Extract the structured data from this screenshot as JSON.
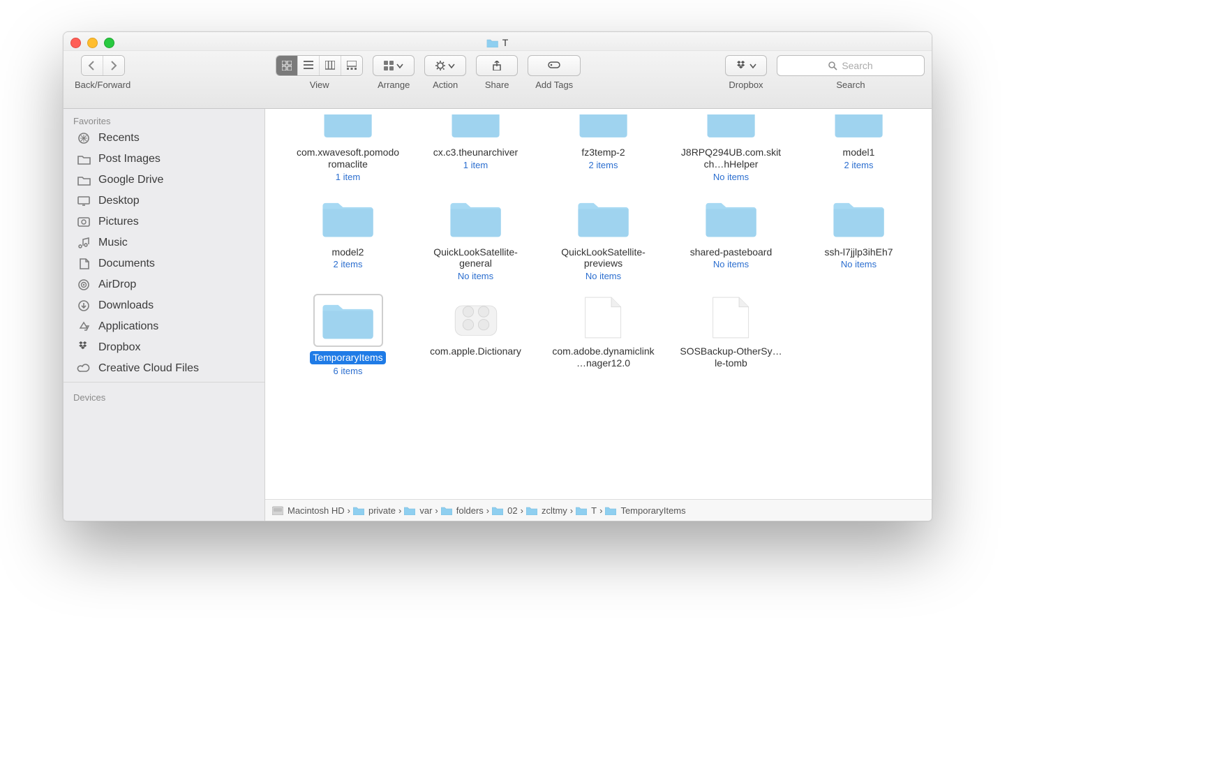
{
  "window": {
    "title": "T"
  },
  "toolbar": {
    "back_forward_label": "Back/Forward",
    "view_label": "View",
    "arrange_label": "Arrange",
    "action_label": "Action",
    "share_label": "Share",
    "add_tags_label": "Add Tags",
    "dropbox_label": "Dropbox",
    "search_label": "Search",
    "search_placeholder": "Search"
  },
  "sidebar": {
    "section_favorites": "Favorites",
    "section_devices": "Devices",
    "items": [
      {
        "icon": "recents",
        "label": "Recents"
      },
      {
        "icon": "folder",
        "label": "Post Images"
      },
      {
        "icon": "folder",
        "label": "Google Drive"
      },
      {
        "icon": "desktop",
        "label": "Desktop"
      },
      {
        "icon": "pictures",
        "label": "Pictures"
      },
      {
        "icon": "music",
        "label": "Music"
      },
      {
        "icon": "documents",
        "label": "Documents"
      },
      {
        "icon": "airdrop",
        "label": "AirDrop"
      },
      {
        "icon": "downloads",
        "label": "Downloads"
      },
      {
        "icon": "applications",
        "label": "Applications"
      },
      {
        "icon": "dropbox",
        "label": "Dropbox"
      },
      {
        "icon": "creative-cloud",
        "label": "Creative Cloud Files"
      }
    ]
  },
  "icons": [
    {
      "type": "folder",
      "name": "com.xwavesoft.pomodoromaclite",
      "meta": "1 item",
      "selected": false,
      "trim": "top"
    },
    {
      "type": "folder",
      "name": "cx.c3.theunarchiver",
      "meta": "1 item",
      "selected": false,
      "trim": "top"
    },
    {
      "type": "folder",
      "name": "fz3temp-2",
      "meta": "2 items",
      "selected": false,
      "trim": "top"
    },
    {
      "type": "folder",
      "name": "J8RPQ294UB.com.skitch…hHelper",
      "meta": "No items",
      "selected": false,
      "trim": "top"
    },
    {
      "type": "folder",
      "name": "model1",
      "meta": "2 items",
      "selected": false,
      "trim": "top"
    },
    {
      "type": "folder",
      "name": "model2",
      "meta": "2 items",
      "selected": false
    },
    {
      "type": "folder",
      "name": "QuickLookSatellite-general",
      "meta": "No items",
      "selected": false
    },
    {
      "type": "folder",
      "name": "QuickLookSatellite-previews",
      "meta": "No items",
      "selected": false
    },
    {
      "type": "folder",
      "name": "shared-pasteboard",
      "meta": "No items",
      "selected": false
    },
    {
      "type": "folder",
      "name": "ssh-l7jjlp3ihEh7",
      "meta": "No items",
      "selected": false
    },
    {
      "type": "folder",
      "name": "TemporaryItems",
      "meta": "6 items",
      "selected": true
    },
    {
      "type": "kext",
      "name": "com.apple.Dictionary",
      "meta": "",
      "selected": false
    },
    {
      "type": "file",
      "name": "com.adobe.dynamiclink…nager12.0",
      "meta": "",
      "selected": false
    },
    {
      "type": "file",
      "name": "SOSBackup-OtherSy…le-tomb",
      "meta": "",
      "selected": false
    }
  ],
  "path": [
    {
      "icon": "disk",
      "label": "Macintosh HD"
    },
    {
      "icon": "folder",
      "label": "private"
    },
    {
      "icon": "folder",
      "label": "var"
    },
    {
      "icon": "folder",
      "label": "folders"
    },
    {
      "icon": "folder",
      "label": "02"
    },
    {
      "icon": "folder",
      "label": "zcltmy"
    },
    {
      "icon": "folder",
      "label": "T"
    },
    {
      "icon": "folder",
      "label": "TemporaryItems"
    }
  ]
}
